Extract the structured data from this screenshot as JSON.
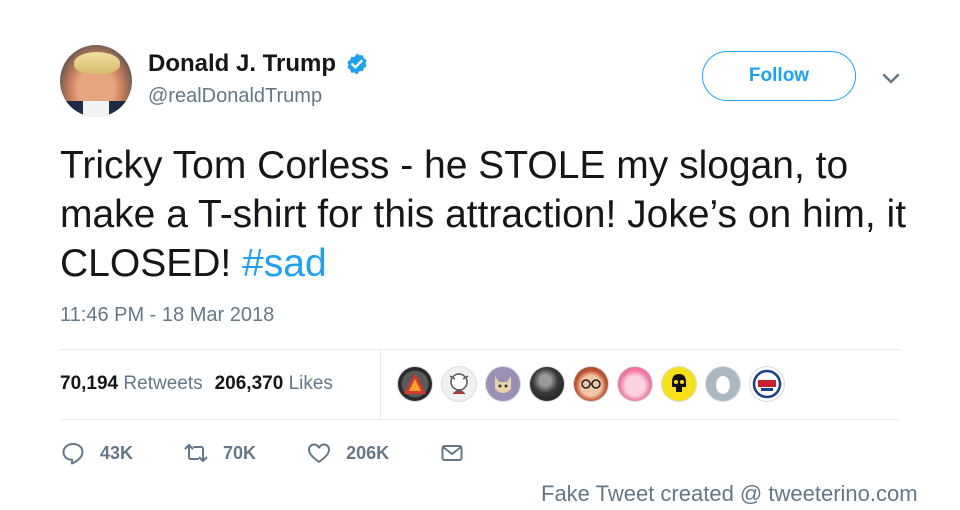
{
  "author": {
    "display_name": "Donald J. Trump",
    "handle": "@realDonaldTrump",
    "verified_icon": "verified-badge-icon"
  },
  "follow_button": {
    "label": "Follow"
  },
  "menu_icon": "chevron-down-icon",
  "tweet": {
    "text": "Tricky Tom Corless - he STOLE my slogan, to make a T-shirt for this attraction! Joke’s on him, it CLOSED! ",
    "hashtag": "#sad",
    "timestamp": "11:46 PM - 18 Mar 2018"
  },
  "stats": {
    "retweets_count": "70,194",
    "retweets_label": "Retweets",
    "likes_count": "206,370",
    "likes_label": "Likes"
  },
  "liked_by_avatars": [
    "red-triangle-avatar",
    "cartoon-character-avatar",
    "cat-avatar",
    "dark-photo-avatar",
    "glasses-face-avatar",
    "pink-face-avatar",
    "yellow-skull-avatar",
    "default-egg-avatar",
    "trump-logo-avatar"
  ],
  "actions": {
    "reply_count": "43K",
    "retweet_count": "70K",
    "like_count": "206K"
  },
  "watermark": "Fake Tweet created @ tweeterino.com",
  "colors": {
    "accent": "#1da1f2",
    "text_primary": "#14171a",
    "text_secondary": "#657786",
    "divider": "#e6ecf0"
  }
}
